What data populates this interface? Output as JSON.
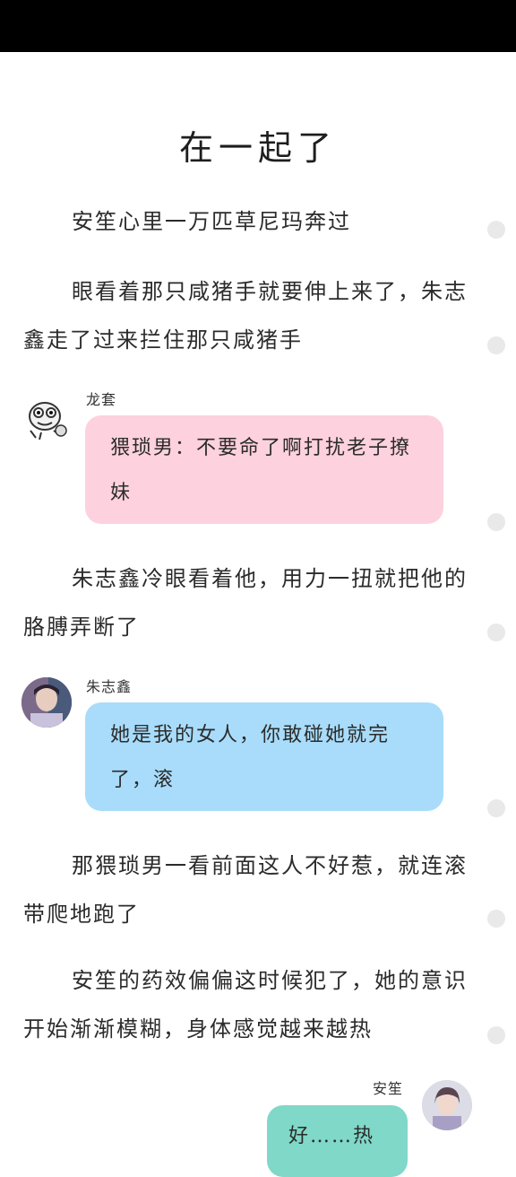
{
  "title": "在一起了",
  "paragraphs": [
    "安笙心里一万匹草尼玛奔过",
    "眼看着那只咸猪手就要伸上来了，朱志鑫走了过来拦住那只咸猪手",
    "朱志鑫冷眼看着他，用力一扭就把他的胳膊弄断了",
    "那猥琐男一看前面这人不好惹，就连滚带爬地跑了",
    "安笙的药效偏偏这时候犯了，她的意识开始渐渐模糊，身体感觉越来越热"
  ],
  "messages": [
    {
      "name": "龙套",
      "text": "猥琐男：不要命了啊打扰老子撩妹",
      "color": "#fdd1dd",
      "avatar": "cartoon-frog-avatar"
    },
    {
      "name": "朱志鑫",
      "text": "她是我的女人，你敢碰她就完了，滚",
      "color": "#a8dcfa",
      "avatar": "boy-photo-avatar"
    },
    {
      "name": "安笙",
      "text": "好……热",
      "color": "#7fd8c8",
      "avatar": "girl-photo-avatar"
    }
  ]
}
